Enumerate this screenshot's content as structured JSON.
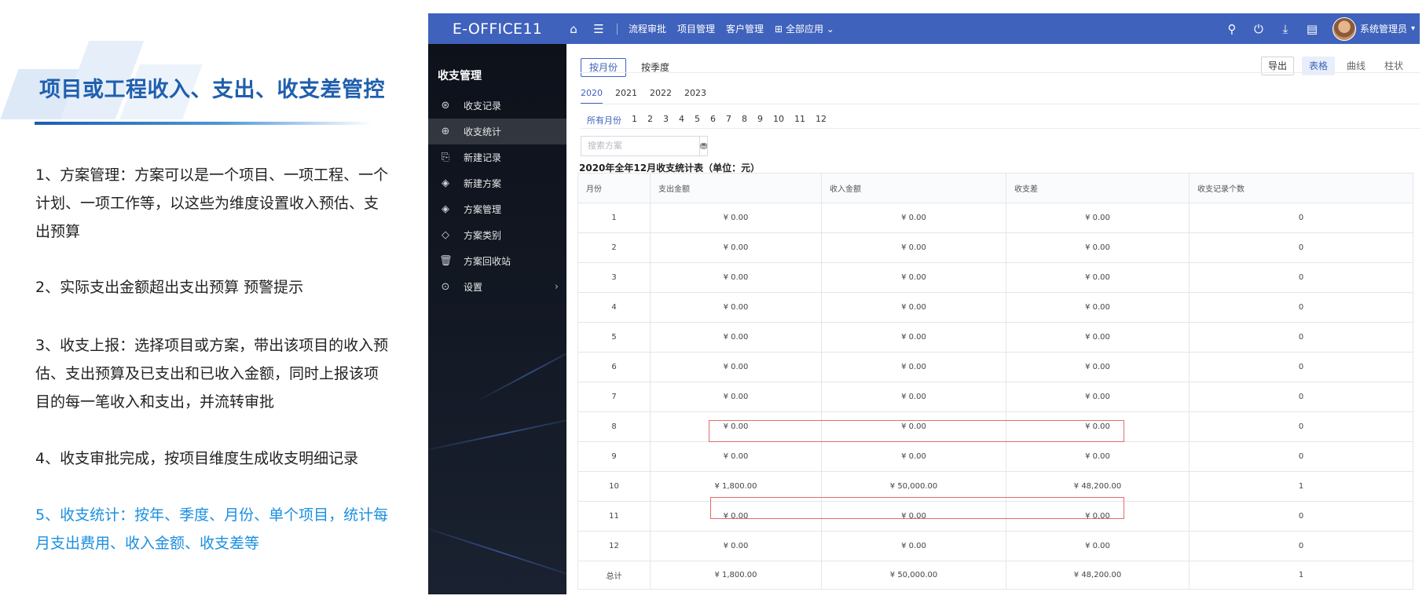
{
  "slide": {
    "title": "项目或工程收入、支出、收支差管控",
    "paragraphs": [
      "1、方案管理：方案可以是一个项目、一项工程、一个计划、一项工作等，以这些为维度设置收入预估、支出预算",
      "2、实际支出金额超出支出预算 预警提示",
      "3、收支上报：选择项目或方案，带出该项目的收入预估、支出预算及已支出和已收入金额，同时上报该项目的每一笔收入和支出，并流转审批",
      "4、收支审批完成，按项目维度生成收支明细记录",
      "5、收支统计：按年、季度、月份、单个项目，统计每月支出费用、收入金额、收支差等"
    ]
  },
  "topbar": {
    "brand": "E-OFFICE11",
    "home_icon": "home-icon",
    "menu_icon": "menu-icon",
    "nav": [
      "流程审批",
      "项目管理",
      "客户管理"
    ],
    "all_apps_label": "全部应用",
    "user_name": "系统管理员",
    "accent": "#3f62bc"
  },
  "sidebar": {
    "title": "收支管理",
    "items": [
      {
        "label": "收支记录",
        "icon": "coins-icon"
      },
      {
        "label": "收支统计",
        "icon": "stats-icon"
      },
      {
        "label": "新建记录",
        "icon": "new-record-icon"
      },
      {
        "label": "新建方案",
        "icon": "new-plan-icon"
      },
      {
        "label": "方案管理",
        "icon": "plan-manage-icon"
      },
      {
        "label": "方案类别",
        "icon": "plan-category-icon"
      },
      {
        "label": "方案回收站",
        "icon": "trash-icon"
      },
      {
        "label": "设置",
        "icon": "settings-icon"
      }
    ],
    "active_index": 1
  },
  "toolbar": {
    "by_month": "按月份",
    "by_quarter": "按季度",
    "export": "导出",
    "views": [
      "表格",
      "曲线",
      "柱状"
    ],
    "active_view": "表格"
  },
  "years": [
    "2020",
    "2021",
    "2022",
    "2023"
  ],
  "active_year": "2020",
  "months": [
    "所有月份",
    "1",
    "2",
    "3",
    "4",
    "5",
    "6",
    "7",
    "8",
    "9",
    "10",
    "11",
    "12"
  ],
  "search": {
    "placeholder": "搜索方案"
  },
  "table": {
    "title": "2020年全年12月收支统计表（单位：元）",
    "columns": [
      "月份",
      "支出金额",
      "收入金额",
      "收支差",
      "收支记录个数"
    ],
    "rows": [
      [
        "1",
        "¥ 0.00",
        "¥ 0.00",
        "¥ 0.00",
        "0"
      ],
      [
        "2",
        "¥ 0.00",
        "¥ 0.00",
        "¥ 0.00",
        "0"
      ],
      [
        "3",
        "¥ 0.00",
        "¥ 0.00",
        "¥ 0.00",
        "0"
      ],
      [
        "4",
        "¥ 0.00",
        "¥ 0.00",
        "¥ 0.00",
        "0"
      ],
      [
        "5",
        "¥ 0.00",
        "¥ 0.00",
        "¥ 0.00",
        "0"
      ],
      [
        "6",
        "¥ 0.00",
        "¥ 0.00",
        "¥ 0.00",
        "0"
      ],
      [
        "7",
        "¥ 0.00",
        "¥ 0.00",
        "¥ 0.00",
        "0"
      ],
      [
        "8",
        "¥ 0.00",
        "¥ 0.00",
        "¥ 0.00",
        "0"
      ],
      [
        "9",
        "¥ 0.00",
        "¥ 0.00",
        "¥ 0.00",
        "0"
      ],
      [
        "10",
        "¥ 1,800.00",
        "¥ 50,000.00",
        "¥ 48,200.00",
        "1"
      ],
      [
        "11",
        "¥ 0.00",
        "¥ 0.00",
        "¥ 0.00",
        "0"
      ],
      [
        "12",
        "¥ 0.00",
        "¥ 0.00",
        "¥ 0.00",
        "0"
      ]
    ],
    "total": [
      "总计",
      "¥ 1,800.00",
      "¥ 50,000.00",
      "¥ 48,200.00",
      "1"
    ],
    "highlight_color": "#e86a6a"
  }
}
